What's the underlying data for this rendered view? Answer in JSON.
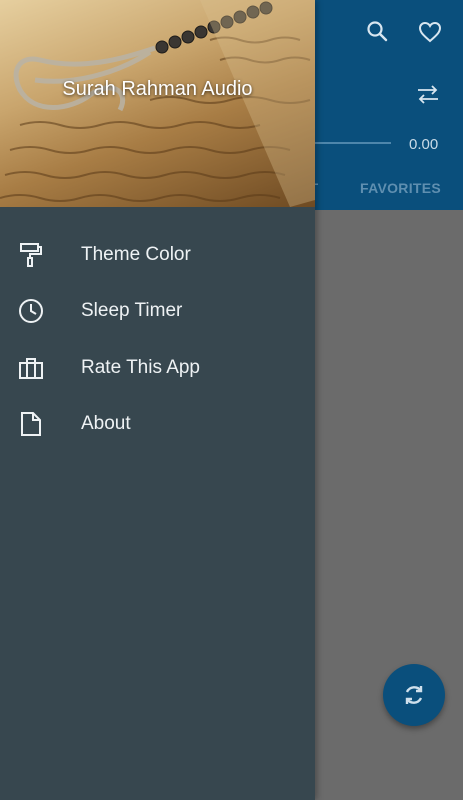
{
  "drawer": {
    "title": "Surah Rahman Audio",
    "items": [
      {
        "label": "Theme Color",
        "icon": "paint-roller-icon"
      },
      {
        "label": "Sleep Timer",
        "icon": "clock-icon"
      },
      {
        "label": "Rate This App",
        "icon": "briefcase-icon"
      },
      {
        "label": "About",
        "icon": "document-icon"
      }
    ]
  },
  "player": {
    "time": "0.00"
  },
  "tabs": {
    "list_fragment": "ST",
    "favorites": "FAVORITES"
  },
  "colors": {
    "app_bar": "#0a4f7c",
    "drawer": "#37474f",
    "scrim_area": "#6b6b6b"
  },
  "icons": {
    "search": "search-icon",
    "favorite": "heart-icon",
    "shuffle": "shuffle-icon",
    "fab": "refresh-icon"
  }
}
